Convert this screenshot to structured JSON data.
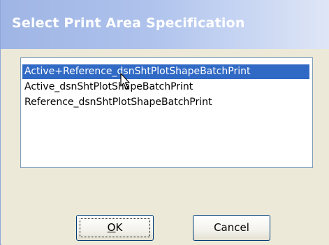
{
  "dialog": {
    "title": "Select Print Area Specification"
  },
  "list": {
    "selected_index": 0,
    "items": [
      "Active+Reference_dsnShtPlotShapeBatchPrint",
      "Active_dsnShtPlotShapeBatchPrint",
      "Reference_dsnShtPlotShapeBatchPrint"
    ]
  },
  "buttons": {
    "ok": {
      "mnemonic": "O",
      "rest": "K"
    },
    "cancel": "Cancel"
  },
  "colors": {
    "selection": "#316ac5",
    "title_text": "#ffffff",
    "dialog_face": "#ece9d8"
  },
  "icons": {
    "cursor": "arrow-cursor-icon"
  }
}
